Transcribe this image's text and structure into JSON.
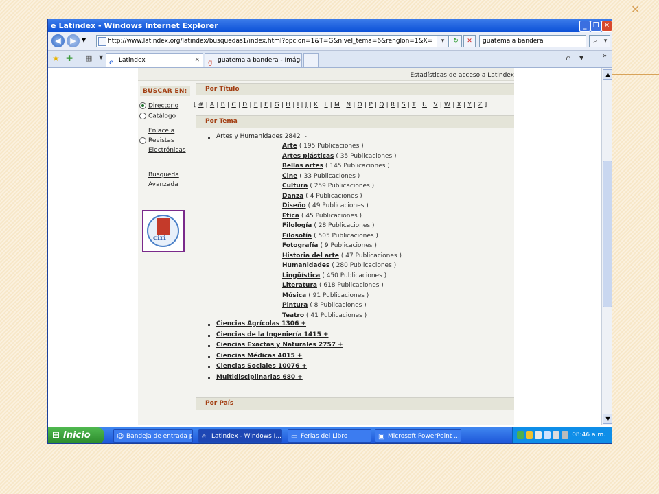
{
  "slide": {
    "corner_mark": "✕"
  },
  "window": {
    "title": "Latindex - Windows Internet Explorer",
    "address": "http://www.latindex.org/latindex/busquedas1/index.html?opcion=1&T=G&nivel_tema=6&renglon=1&X=",
    "search_text": "guatemala bandera",
    "tabs": [
      {
        "label": "Latindex",
        "active": true
      },
      {
        "label": "guatemala bandera - Imágen...",
        "active": false
      }
    ]
  },
  "sidebar": {
    "heading": "BUSCAR EN:",
    "options": [
      {
        "label": "Directorio",
        "selected": true
      },
      {
        "label": "Catálogo",
        "selected": false
      },
      {
        "label_lines": [
          "Enlace a",
          "Revistas",
          "Electrónicas"
        ],
        "selected": false
      }
    ],
    "advanced": [
      "Busqueda",
      "Avanzada"
    ],
    "logo_text": "ciri"
  },
  "main": {
    "stats_link": "Estadísticas de acceso a Latindex",
    "por_titulo": "Por Título",
    "letters": [
      "#",
      "A",
      "B",
      "C",
      "D",
      "E",
      "F",
      "G",
      "H",
      "I",
      "J",
      "K",
      "L",
      "M",
      "N",
      "O",
      "P",
      "Q",
      "R",
      "S",
      "T",
      "U",
      "V",
      "W",
      "X",
      "Y",
      "Z"
    ],
    "por_tema": "Por Tema",
    "expanded_topic": {
      "label": "Artes y Humanidades 2842",
      "toggle": "-"
    },
    "subtopics": [
      {
        "name": "Arte",
        "count": "( 195 Publicaciones )"
      },
      {
        "name": "Artes plásticas",
        "count": "( 35 Publicaciones )"
      },
      {
        "name": "Bellas artes",
        "count": "( 145 Publicaciones )"
      },
      {
        "name": "Cine",
        "count": "( 33 Publicaciones )"
      },
      {
        "name": "Cultura",
        "count": "( 259 Publicaciones )"
      },
      {
        "name": "Danza",
        "count": "( 4 Publicaciones )"
      },
      {
        "name": "Diseño",
        "count": "( 49 Publicaciones )"
      },
      {
        "name": "Etica",
        "count": "( 45 Publicaciones )"
      },
      {
        "name": "Filología",
        "count": "( 28 Publicaciones )"
      },
      {
        "name": "Filosofía",
        "count": "( 505 Publicaciones )"
      },
      {
        "name": "Fotografía",
        "count": "( 9 Publicaciones )"
      },
      {
        "name": "Historia del arte",
        "count": "( 47 Publicaciones )"
      },
      {
        "name": "Humanidades",
        "count": "( 280 Publicaciones )"
      },
      {
        "name": "Lingüística",
        "count": "( 450 Publicaciones )"
      },
      {
        "name": "Literatura",
        "count": "( 618 Publicaciones )"
      },
      {
        "name": "Música",
        "count": "( 91 Publicaciones )"
      },
      {
        "name": "Pintura",
        "count": "( 8 Publicaciones )"
      },
      {
        "name": "Teatro",
        "count": "( 41 Publicaciones )"
      }
    ],
    "topics": [
      "Ciencias Agrícolas 1306  +",
      "Ciencias de la Ingeniería 1415  +",
      "Ciencias Exactas y Naturales 2757  +",
      "Ciencias Médicas 4015  +",
      "Ciencias Sociales 10076  +",
      "Multidisciplinarias 680  +"
    ],
    "por_pais": "Por País"
  },
  "taskbar": {
    "start": "Inicio",
    "buttons": [
      {
        "label": "Bandeja de entrada p...",
        "icon": "☺",
        "active": false
      },
      {
        "label": "Latindex - Windows I...",
        "icon": "e",
        "active": true
      },
      {
        "label": "Ferias del Libro",
        "icon": "▭",
        "active": false
      },
      {
        "label": "Microsoft PowerPoint ...",
        "icon": "▣",
        "active": false
      }
    ],
    "clock": "08:46 a.m."
  }
}
